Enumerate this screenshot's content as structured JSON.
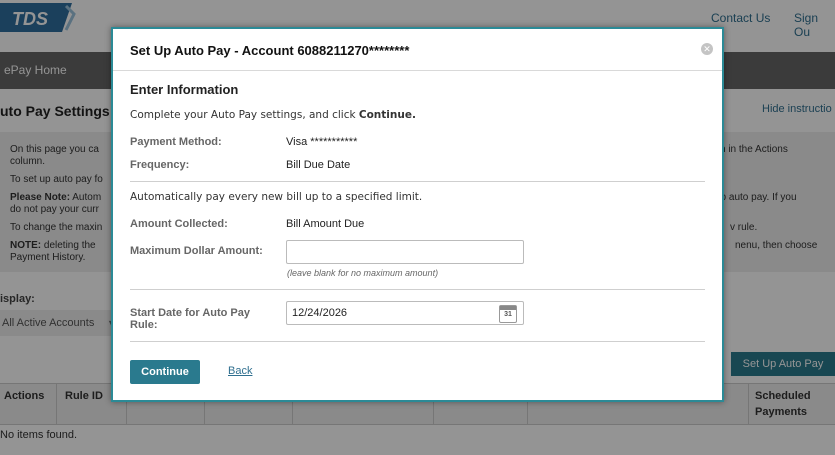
{
  "brand": {
    "logo_text": "TDS"
  },
  "header": {
    "contact_label": "Contact Us",
    "sign_out_label": "Sign Ou"
  },
  "nav": {
    "epay_home_label": "ePay Home"
  },
  "page": {
    "title": "uto Pay Settings",
    "hide_instructions_label": "Hide instructio",
    "instructions": {
      "line1_left": "On this page you ca",
      "line1_right": "n in the Actions",
      "line2": "column.",
      "line3": "To set up auto pay fo",
      "line4_bold": "Please Note:",
      "line4_rest": " Autom",
      "line4_right": "up auto pay. If you",
      "line5": "do not pay your curr",
      "line6_left": "To change the maxin",
      "line6_right": "v rule.",
      "line7_bold": "NOTE:",
      "line7_rest": " deleting the",
      "line7_right": "nenu, then choose",
      "line8": "Payment History."
    },
    "display_label": "isplay:",
    "filter_value": "All Active Accounts",
    "setup_button_label": "Set Up Auto Pay",
    "table": {
      "headers": {
        "actions": "Actions",
        "rule_id": "Rule ID",
        "scheduled_line1": "Scheduled",
        "scheduled_line2": "Payments"
      },
      "empty_message": "No items found."
    }
  },
  "modal": {
    "title": "Set Up Auto Pay - Account 6088211270********",
    "close_symbol": "✕",
    "section_title": "Enter Information",
    "intro_text": "Complete your Auto Pay settings, and click ",
    "intro_bold": "Continue.",
    "payment_method_label": "Payment Method:",
    "payment_method_value": "Visa ***********",
    "frequency_label": "Frequency:",
    "frequency_value": "Bill Due Date",
    "auto_text": "Automatically pay every new bill up to a specified limit.",
    "amount_collected_label": "Amount Collected:",
    "amount_collected_value": "Bill Amount Due",
    "max_amount_label": "Maximum Dollar Amount:",
    "max_amount_value": "",
    "max_amount_hint": "(leave blank for no maximum amount)",
    "start_date_label_line1": "Start Date for Auto Pay",
    "start_date_label_line2": "Rule:",
    "start_date_value": "12/24/2026",
    "calendar_day": "31",
    "continue_label": "Continue",
    "back_label": "Back"
  },
  "colors": {
    "accent": "#2a7a8e",
    "link": "#2f6f8f",
    "modal_border": "#2b8a96"
  }
}
